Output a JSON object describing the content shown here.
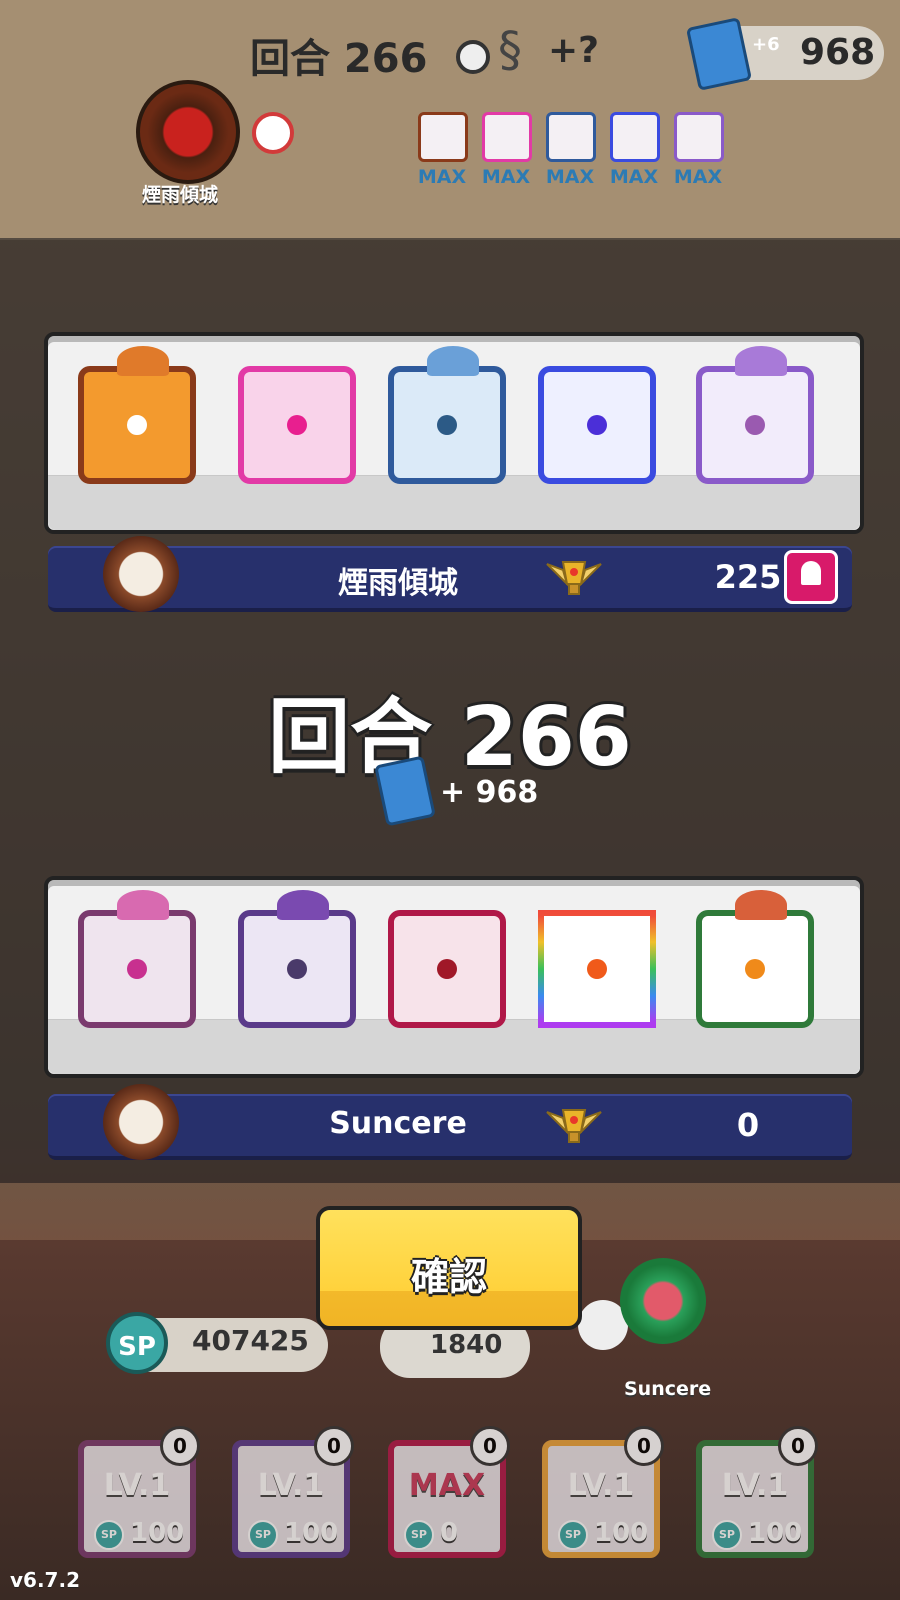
{
  "hud": {
    "round_label": "回合 266",
    "snake_bonus": "+?",
    "card_bonus": "+6",
    "card_total": "968",
    "opponent_name": "煙雨傾城",
    "upgrade_labels": [
      "MAX",
      "MAX",
      "MAX",
      "MAX",
      "MAX"
    ]
  },
  "result": {
    "opponent": {
      "name": "煙雨傾城",
      "trophies": "225",
      "rank_stars": 2
    },
    "round_title": "回合 266",
    "reward": "+ 968",
    "player": {
      "name": "Suncere",
      "trophies": "0",
      "rank_stars": 1
    },
    "confirm_label": "確認"
  },
  "opponent_deck": [
    {
      "icon": "fire-die-icon",
      "border": "#8a3a1a",
      "fill": "#f39a2e",
      "pip": "#f39a2e"
    },
    {
      "icon": "shield-break-die-icon",
      "border": "#e23aa6",
      "fill": "#f9d3ea",
      "pip": "#e81f8f"
    },
    {
      "icon": "moon-die-icon",
      "border": "#2f5a9c",
      "fill": "#dbeaf8",
      "pip": "#2c5a86"
    },
    {
      "icon": "teleport-die-icon",
      "border": "#3a4be0",
      "fill": "#eef0ff",
      "pip": "#4b2fd8"
    },
    {
      "icon": "star-die-icon",
      "border": "#8a5ac9",
      "fill": "#f2ecfb",
      "pip": "#9a5ab0"
    }
  ],
  "player_deck": [
    {
      "icon": "sword-die-icon",
      "border": "#7a3a6e",
      "fill": "#efe4ee",
      "pip": "#c8308f"
    },
    {
      "icon": "eye-die-icon",
      "border": "#5a3a8a",
      "fill": "#ece6f4",
      "pip": "#4a3a6a"
    },
    {
      "icon": "dna-die-icon",
      "border": "#b01848",
      "fill": "#f7e3ea",
      "pip": "#a01828"
    },
    {
      "icon": "rainbow-die-icon",
      "border": "#e8a23a",
      "fill": "#ffffff",
      "pip": "#f05a1a"
    },
    {
      "icon": "infinity-die-icon",
      "border": "#2f7a3a",
      "fill": "#ffffff",
      "pip": "#f08a1a"
    }
  ],
  "bottom": {
    "sp_label": "SP",
    "sp_total": "407425",
    "summon_cost": "1840",
    "player_name": "Suncere",
    "version": "v6.7.2",
    "cards": [
      {
        "level": "LV.1",
        "cost": "100",
        "count": "0"
      },
      {
        "level": "LV.1",
        "cost": "100",
        "count": "0"
      },
      {
        "level": "MAX",
        "cost": "0",
        "count": "0"
      },
      {
        "level": "LV.1",
        "cost": "100",
        "count": "0"
      },
      {
        "level": "LV.1",
        "cost": "100",
        "count": "0"
      }
    ]
  },
  "colors": {
    "namebar": "#27306c",
    "confirm": "#ffd23c",
    "max_text": "#2c7bb4"
  }
}
